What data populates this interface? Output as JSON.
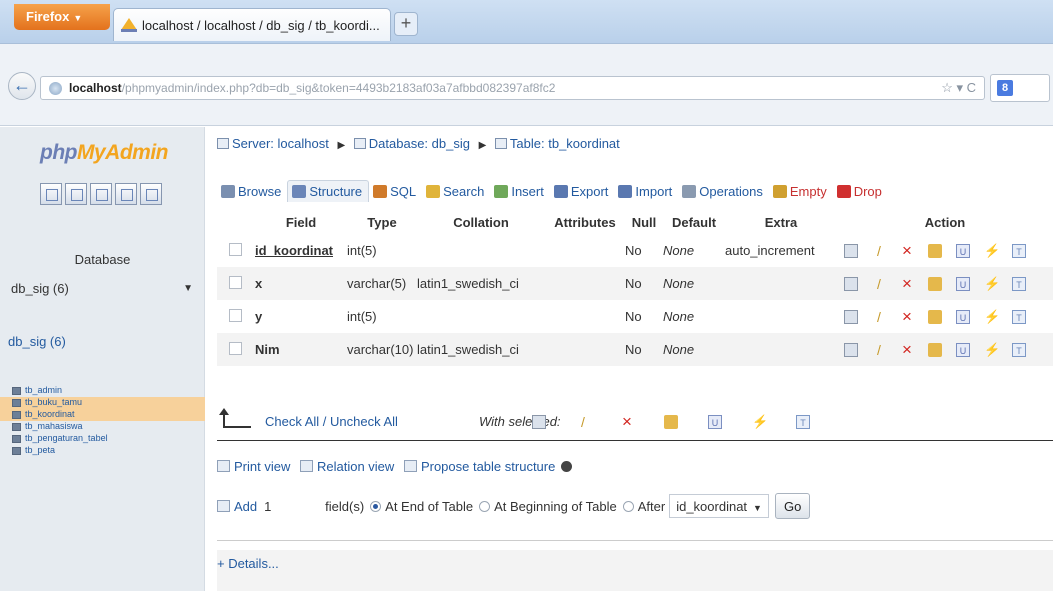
{
  "browser": {
    "app_button": "Firefox",
    "tab_title": "localhost / localhost / db_sig / tb_koordi...",
    "new_tab": "+",
    "url_host": "localhost",
    "url_path": "/phpmyadmin/index.php?db=db_sig&token=4493b2183af03a7afbbd082397af8fc2",
    "url_tools": "☆ ▾ C"
  },
  "sidebar": {
    "logo_php": "php",
    "logo_myadmin": "MyAdmin",
    "database_label": "Database",
    "database_select": "db_sig (6)",
    "db_link": "db_sig (6)",
    "tables": [
      "tb_admin",
      "tb_buku_tamu",
      "tb_koordinat",
      "tb_mahasiswa",
      "tb_pengaturan_tabel",
      "tb_peta"
    ],
    "highlighted_tables": [
      "tb_buku_tamu",
      "tb_koordinat"
    ]
  },
  "breadcrumb": {
    "server": "Server: localhost",
    "database": "Database: db_sig",
    "table": "Table: tb_koordinat"
  },
  "tabs": [
    {
      "label": "Browse",
      "color": "#7a8fb0"
    },
    {
      "label": "Structure",
      "color": "#6b86b8",
      "active": true
    },
    {
      "label": "SQL",
      "color": "#d07a2a"
    },
    {
      "label": "Search",
      "color": "#e0b43a"
    },
    {
      "label": "Insert",
      "color": "#6fa85a"
    },
    {
      "label": "Export",
      "color": "#5a78b0"
    },
    {
      "label": "Import",
      "color": "#5a78b0"
    },
    {
      "label": "Operations",
      "color": "#8a9ab0"
    },
    {
      "label": "Empty",
      "color": "#d0a030"
    },
    {
      "label": "Drop",
      "color": "#d03030"
    }
  ],
  "structure": {
    "columns": [
      "",
      "Field",
      "Type",
      "Collation",
      "Attributes",
      "Null",
      "Default",
      "Extra",
      "Action"
    ],
    "rows": [
      {
        "field": "id_koordinat",
        "type": "int(5)",
        "collation": "",
        "attributes": "",
        "null": "No",
        "default": "None",
        "extra": "auto_increment"
      },
      {
        "field": "x",
        "type": "varchar(5)",
        "collation": "latin1_swedish_ci",
        "attributes": "",
        "null": "No",
        "default": "None",
        "extra": ""
      },
      {
        "field": "y",
        "type": "int(5)",
        "collation": "",
        "attributes": "",
        "null": "No",
        "default": "None",
        "extra": ""
      },
      {
        "field": "Nim",
        "type": "varchar(10)",
        "collation": "latin1_swedish_ci",
        "attributes": "",
        "null": "No",
        "default": "None",
        "extra": ""
      }
    ],
    "action_icons": [
      "browse-icon",
      "edit-icon",
      "drop-icon",
      "primary-key-icon",
      "unique-icon",
      "index-icon",
      "fulltext-icon"
    ]
  },
  "with_selected": {
    "check_all": "Check All / Uncheck All",
    "label": "With selected:"
  },
  "tools": {
    "print_view": "Print view",
    "relation_view": "Relation view",
    "propose": "Propose table structure"
  },
  "add_fields": {
    "add_label": "Add",
    "count": "1",
    "fields_label": "field(s)",
    "at_end": "At End of Table",
    "at_beginning": "At Beginning of Table",
    "after": "After",
    "after_select": "id_koordinat",
    "go": "Go"
  },
  "details": "+ Details..."
}
